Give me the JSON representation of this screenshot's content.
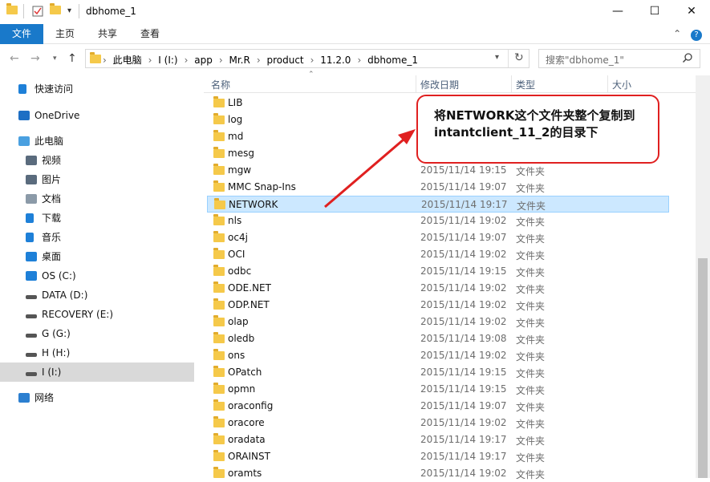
{
  "window": {
    "title": "dbhome_1",
    "minimize": "—",
    "maximize": "☐",
    "close": "✕"
  },
  "ribbon": {
    "tabs": [
      "文件",
      "主页",
      "共享",
      "查看"
    ],
    "collapse": "⌃",
    "help": "?"
  },
  "address": {
    "crumbs": [
      "此电脑",
      "I (I:)",
      "app",
      "Mr.R",
      "product",
      "11.2.0",
      "dbhome_1"
    ],
    "refresh": "↻",
    "search_placeholder": "搜索\"dbhome_1\""
  },
  "sidebar": {
    "items": [
      {
        "label": "快速访问",
        "icon": "star-icon",
        "color": "#1e80d8"
      },
      {
        "label": "OneDrive",
        "icon": "cloud-icon",
        "color": "#1e6fc4"
      },
      {
        "label": "此电脑",
        "icon": "computer-icon",
        "color": "#4aa0e0"
      },
      {
        "label": "视频",
        "icon": "video-icon",
        "color": "#5a6b7d"
      },
      {
        "label": "图片",
        "icon": "pictures-icon",
        "color": "#5a6b7d"
      },
      {
        "label": "文档",
        "icon": "documents-icon",
        "color": "#8b9aa8"
      },
      {
        "label": "下载",
        "icon": "download-icon",
        "color": "#1e80d8"
      },
      {
        "label": "音乐",
        "icon": "music-icon",
        "color": "#1e80d8"
      },
      {
        "label": "桌面",
        "icon": "desktop-icon",
        "color": "#1e80d8"
      },
      {
        "label": "OS (C:)",
        "icon": "windows-drive-icon",
        "color": "#1e80d8"
      },
      {
        "label": "DATA (D:)",
        "icon": "drive-icon",
        "color": "#555555"
      },
      {
        "label": "RECOVERY (E:)",
        "icon": "drive-icon",
        "color": "#555555"
      },
      {
        "label": "G (G:)",
        "icon": "drive-icon",
        "color": "#555555"
      },
      {
        "label": "H (H:)",
        "icon": "drive-icon",
        "color": "#555555"
      },
      {
        "label": "I (I:)",
        "icon": "drive-icon",
        "color": "#555555"
      },
      {
        "label": "网络",
        "icon": "network-icon",
        "color": "#2c7fd0"
      }
    ]
  },
  "columns": {
    "name": "名称",
    "date": "修改日期",
    "type": "类型",
    "size": "大小"
  },
  "files": [
    {
      "name": "LIB",
      "date": "",
      "type": ""
    },
    {
      "name": "log",
      "date": "",
      "type": ""
    },
    {
      "name": "md",
      "date": "",
      "type": ""
    },
    {
      "name": "mesg",
      "date": "",
      "type": ""
    },
    {
      "name": "mgw",
      "date": "2015/11/14 19:15",
      "type": "文件夹"
    },
    {
      "name": "MMC Snap-Ins",
      "date": "2015/11/14 19:07",
      "type": "文件夹"
    },
    {
      "name": "NETWORK",
      "date": "2015/11/14 19:17",
      "type": "文件夹"
    },
    {
      "name": "nls",
      "date": "2015/11/14 19:02",
      "type": "文件夹"
    },
    {
      "name": "oc4j",
      "date": "2015/11/14 19:07",
      "type": "文件夹"
    },
    {
      "name": "OCI",
      "date": "2015/11/14 19:02",
      "type": "文件夹"
    },
    {
      "name": "odbc",
      "date": "2015/11/14 19:15",
      "type": "文件夹"
    },
    {
      "name": "ODE.NET",
      "date": "2015/11/14 19:02",
      "type": "文件夹"
    },
    {
      "name": "ODP.NET",
      "date": "2015/11/14 19:02",
      "type": "文件夹"
    },
    {
      "name": "olap",
      "date": "2015/11/14 19:02",
      "type": "文件夹"
    },
    {
      "name": "oledb",
      "date": "2015/11/14 19:08",
      "type": "文件夹"
    },
    {
      "name": "ons",
      "date": "2015/11/14 19:02",
      "type": "文件夹"
    },
    {
      "name": "OPatch",
      "date": "2015/11/14 19:15",
      "type": "文件夹"
    },
    {
      "name": "opmn",
      "date": "2015/11/14 19:15",
      "type": "文件夹"
    },
    {
      "name": "oraconfig",
      "date": "2015/11/14 19:07",
      "type": "文件夹"
    },
    {
      "name": "oracore",
      "date": "2015/11/14 19:02",
      "type": "文件夹"
    },
    {
      "name": "oradata",
      "date": "2015/11/14 19:17",
      "type": "文件夹"
    },
    {
      "name": "ORAINST",
      "date": "2015/11/14 19:17",
      "type": "文件夹"
    },
    {
      "name": "oramts",
      "date": "2015/11/14 19:02",
      "type": "文件夹"
    }
  ],
  "annotation": {
    "text": "将NETWORK这个文件夹整个复制到intantclient_11_2的目录下",
    "color": "#e02020"
  },
  "colors": {
    "accent": "#1979ca",
    "selected_row": "#cce8ff",
    "folder": "#f5c94a"
  }
}
